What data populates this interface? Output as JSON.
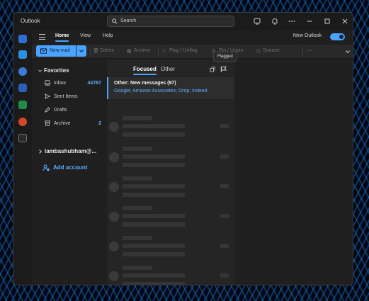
{
  "app": {
    "title": "Outlook"
  },
  "search": {
    "placeholder": "Search"
  },
  "ribbon_tabs": [
    "Home",
    "View",
    "Help"
  ],
  "new_outlook": {
    "label": "New Outlook",
    "enabled": true
  },
  "ribbon": {
    "new_mail": "New mail",
    "delete": "Delete",
    "archive": "Archive",
    "flag": "Flag / Unflag",
    "pin": "Pin / Unpin",
    "snooze": "Snooze",
    "more": "···"
  },
  "tooltip": "Flagged",
  "folders": {
    "favorites_label": "Favorites",
    "items": [
      {
        "label": "Inbox",
        "count": "44787",
        "icon": "inbox-icon"
      },
      {
        "label": "Sent Items",
        "count": "",
        "icon": "send-icon"
      },
      {
        "label": "Drafts",
        "count": "",
        "icon": "pencil-icon"
      },
      {
        "label": "Archive",
        "count": "2",
        "icon": "archive-icon"
      }
    ],
    "account": "lambashubham@...",
    "add_account": "Add account"
  },
  "message_list": {
    "tabs": [
      "Focused",
      "Other"
    ],
    "first": {
      "subject": "Other: New messages (97)",
      "preview": "Google; Amazon Associates; Drop; Indeed"
    }
  },
  "colors": {
    "accent": "#4aa3ff",
    "background": "#1f1f1f"
  }
}
